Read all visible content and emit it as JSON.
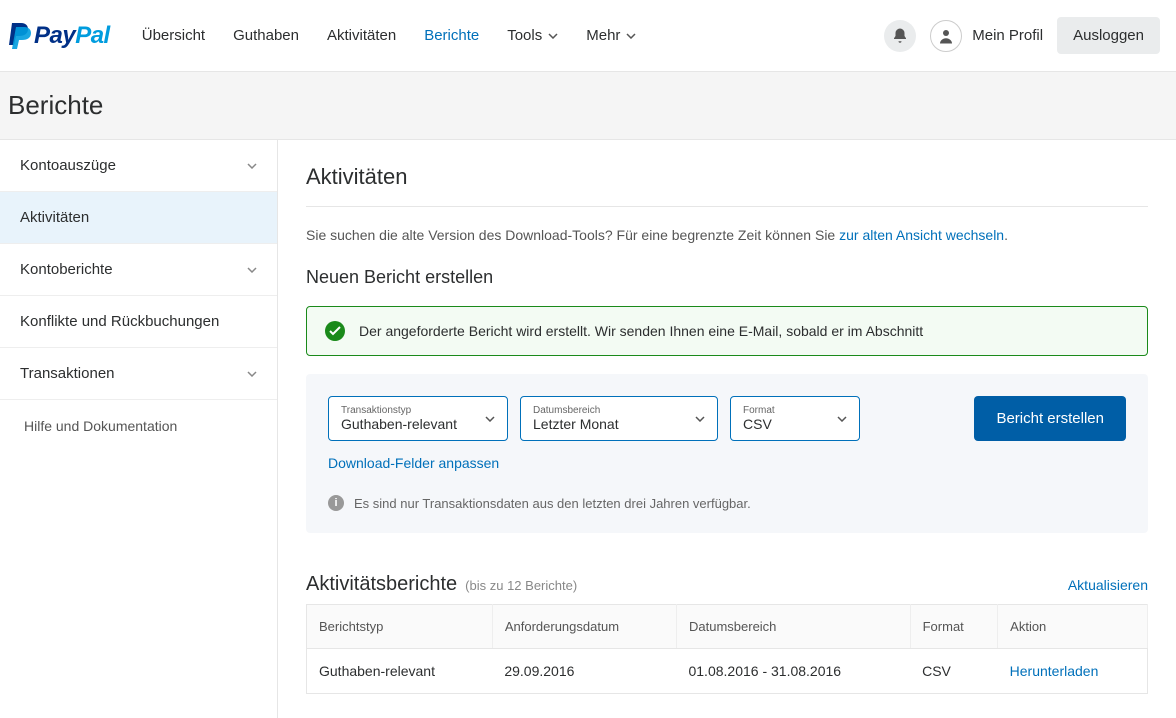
{
  "header": {
    "nav": [
      "Übersicht",
      "Guthaben",
      "Aktivitäten",
      "Berichte",
      "Tools",
      "Mehr"
    ],
    "active_nav_index": 3,
    "profile_label": "Mein Profil",
    "logout_label": "Ausloggen"
  },
  "page_title": "Berichte",
  "sidebar": {
    "items": [
      {
        "label": "Kontoauszüge",
        "expandable": true
      },
      {
        "label": "Aktivitäten",
        "expandable": false,
        "selected": true
      },
      {
        "label": "Kontoberichte",
        "expandable": true
      },
      {
        "label": "Konflikte und Rückbuchungen",
        "expandable": false
      },
      {
        "label": "Transaktionen",
        "expandable": true
      }
    ],
    "help_label": "Hilfe und Dokumentation"
  },
  "main": {
    "section_title": "Aktivitäten",
    "legacy_text_prefix": "Sie suchen die alte Version des Download-Tools? Für eine begrenzte Zeit können Sie ",
    "legacy_link": "zur alten Ansicht wechseln",
    "legacy_text_suffix": ".",
    "create_title": "Neuen Bericht erstellen",
    "success_message": "Der angeforderte Bericht wird erstellt. Wir senden Ihnen eine E-Mail, sobald er im Abschnitt",
    "form": {
      "transaction_type": {
        "label": "Transaktionstyp",
        "value": "Guthaben-relevant"
      },
      "date_range": {
        "label": "Datumsbereich",
        "value": "Letzter Monat"
      },
      "format": {
        "label": "Format",
        "value": "CSV"
      },
      "submit_label": "Bericht erstellen",
      "customize_link": "Download-Felder anpassen",
      "note": "Es sind nur Transaktionsdaten aus den letzten drei Jahren verfügbar."
    },
    "reports": {
      "title": "Aktivitätsberichte",
      "subtitle": "(bis zu 12 Berichte)",
      "refresh_label": "Aktualisieren",
      "columns": [
        "Berichtstyp",
        "Anforderungsdatum",
        "Datumsbereich",
        "Format",
        "Aktion"
      ],
      "rows": [
        {
          "type": "Guthaben-relevant",
          "requested": "29.09.2016",
          "range": "01.08.2016 - 31.08.2016",
          "format": "CSV",
          "action": "Herunterladen"
        }
      ]
    }
  }
}
